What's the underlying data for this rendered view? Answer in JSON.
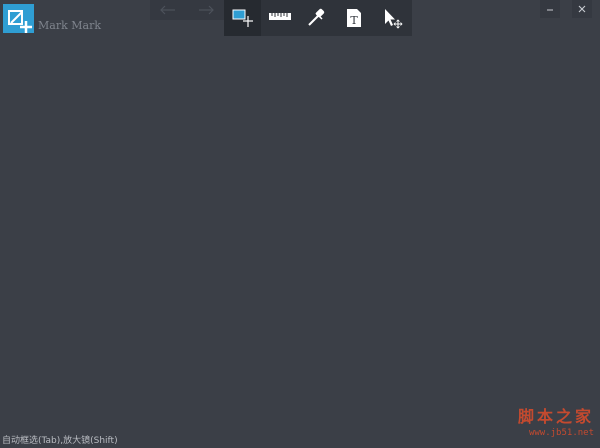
{
  "app": {
    "title": "Mark Mark"
  },
  "history": {
    "undo_icon": "undo-arrow-icon",
    "redo_icon": "redo-arrow-icon"
  },
  "toolbar": {
    "tools": [
      {
        "id": "area-select",
        "icon": "rect-select-plus-icon",
        "active": true
      },
      {
        "id": "ruler",
        "icon": "ruler-icon",
        "active": false
      },
      {
        "id": "color-picker",
        "icon": "eyedropper-icon",
        "active": false
      },
      {
        "id": "text",
        "icon": "text-tool-icon",
        "glyph": "T",
        "active": false
      },
      {
        "id": "move",
        "icon": "cursor-move-icon",
        "active": false
      }
    ]
  },
  "window_controls": {
    "minimize": "–",
    "close": "×"
  },
  "status": {
    "text": "自动框选(Tab),放大镜(Shift)"
  },
  "watermark": {
    "main": "脚本之家",
    "sub": "www.jb51.net"
  },
  "colors": {
    "background": "#3b3f47",
    "toolbar": "#2f333a",
    "accent": "#2f9ed3",
    "watermark": "#c44a2f"
  }
}
